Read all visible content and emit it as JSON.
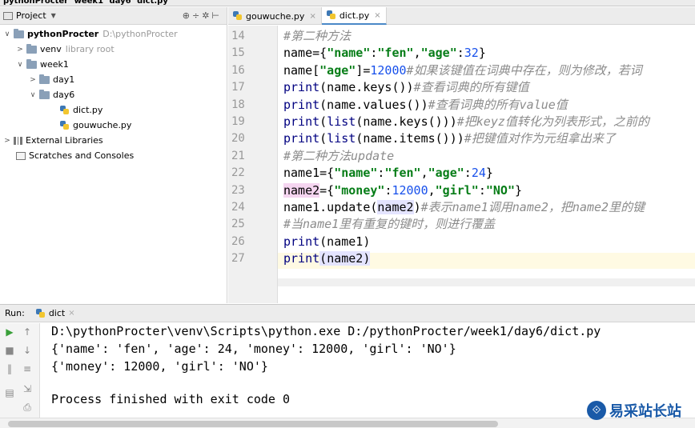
{
  "breadcrumb": [
    "pythonProcter",
    "week1",
    "day6",
    "dict.py"
  ],
  "project_panel": {
    "title": "Project",
    "tree": [
      {
        "label": "pythonProcter",
        "extra": "D:\\pythonProcter",
        "toggle": "∨"
      },
      {
        "label": "venv",
        "extra": "library root",
        "toggle": ">"
      },
      {
        "label": "week1",
        "extra": "",
        "toggle": "∨"
      },
      {
        "label": "day1",
        "extra": "",
        "toggle": ">"
      },
      {
        "label": "day6",
        "extra": "",
        "toggle": "∨"
      },
      {
        "label": "dict.py",
        "extra": "",
        "toggle": ""
      },
      {
        "label": "gouwuche.py",
        "extra": "",
        "toggle": ""
      },
      {
        "label": "External Libraries",
        "extra": "",
        "toggle": ">"
      },
      {
        "label": "Scratches and Consoles",
        "extra": "",
        "toggle": ""
      }
    ]
  },
  "editor": {
    "tabs": [
      {
        "label": "gouwuche.py",
        "active": false
      },
      {
        "label": "dict.py",
        "active": true
      }
    ],
    "line_numbers": [
      "14",
      "15",
      "16",
      "17",
      "18",
      "19",
      "20",
      "21",
      "22",
      "23",
      "24",
      "25",
      "26",
      "27"
    ],
    "lines": [
      [
        {
          "t": "#第二种方法",
          "k": "c"
        }
      ],
      [
        {
          "t": "name={",
          "k": ""
        },
        {
          "t": "\"name\"",
          "k": "s"
        },
        {
          "t": ":",
          "k": ""
        },
        {
          "t": "\"fen\"",
          "k": "s"
        },
        {
          "t": ",",
          "k": ""
        },
        {
          "t": "\"age\"",
          "k": "s"
        },
        {
          "t": ":",
          "k": ""
        },
        {
          "t": "32",
          "k": "n"
        },
        {
          "t": "}",
          "k": ""
        }
      ],
      [
        {
          "t": "name[",
          "k": ""
        },
        {
          "t": "\"age\"",
          "k": "s"
        },
        {
          "t": "]=",
          "k": ""
        },
        {
          "t": "12000",
          "k": "n"
        },
        {
          "t": "#如果该键值在词典中存在，则为修改，若词",
          "k": "c"
        }
      ],
      [
        {
          "t": "print",
          "k": "f"
        },
        {
          "t": "(name.keys())",
          "k": ""
        },
        {
          "t": "#查看词典的所有键值",
          "k": "c"
        }
      ],
      [
        {
          "t": "print",
          "k": "f"
        },
        {
          "t": "(name.values())",
          "k": ""
        },
        {
          "t": "#查看词典的所有value值",
          "k": "c"
        }
      ],
      [
        {
          "t": "print",
          "k": "f"
        },
        {
          "t": "(",
          "k": ""
        },
        {
          "t": "list",
          "k": "f"
        },
        {
          "t": "(name.keys()))",
          "k": ""
        },
        {
          "t": "#把keyz值转化为列表形式，之前的",
          "k": "c"
        }
      ],
      [
        {
          "t": "print",
          "k": "f"
        },
        {
          "t": "(",
          "k": ""
        },
        {
          "t": "list",
          "k": "f"
        },
        {
          "t": "(name.items()))",
          "k": ""
        },
        {
          "t": "#把键值对作为元组拿出来了",
          "k": "c"
        }
      ],
      [
        {
          "t": "#第二种方法update",
          "k": "c"
        }
      ],
      [
        {
          "t": "name1={",
          "k": ""
        },
        {
          "t": "\"name\"",
          "k": "s"
        },
        {
          "t": ":",
          "k": ""
        },
        {
          "t": "\"fen\"",
          "k": "s"
        },
        {
          "t": ",",
          "k": ""
        },
        {
          "t": "\"age\"",
          "k": "s"
        },
        {
          "t": ":",
          "k": ""
        },
        {
          "t": "24",
          "k": "n"
        },
        {
          "t": "}",
          "k": ""
        }
      ],
      [
        {
          "t": "name2",
          "k": "hl2"
        },
        {
          "t": "={",
          "k": ""
        },
        {
          "t": "\"money\"",
          "k": "s"
        },
        {
          "t": ":",
          "k": ""
        },
        {
          "t": "12000",
          "k": "n"
        },
        {
          "t": ",",
          "k": ""
        },
        {
          "t": "\"girl\"",
          "k": "s"
        },
        {
          "t": ":",
          "k": ""
        },
        {
          "t": "\"NO\"",
          "k": "s"
        },
        {
          "t": "}",
          "k": ""
        }
      ],
      [
        {
          "t": "name1.update(",
          "k": ""
        },
        {
          "t": "name2",
          "k": "hl"
        },
        {
          "t": ")",
          "k": ""
        },
        {
          "t": "#表示name1调用name2，把name2里的键",
          "k": "c"
        }
      ],
      [
        {
          "t": "#当name1里有重复的键时，则进行覆盖",
          "k": "c"
        }
      ],
      [
        {
          "t": "print",
          "k": "f"
        },
        {
          "t": "(name1)",
          "k": ""
        }
      ],
      [
        {
          "t": "print",
          "k": "f"
        },
        {
          "t": "(",
          "k": "hl"
        },
        {
          "t": "name2",
          "k": "hl"
        },
        {
          "t": ")",
          "k": "hl"
        }
      ]
    ]
  },
  "run_panel": {
    "label": "Run:",
    "tab": "dict",
    "output": [
      "D:\\pythonProcter\\venv\\Scripts\\python.exe D:/pythonProcter/week1/day6/dict.py",
      "{'name': 'fen', 'age': 24, 'money': 12000, 'girl': 'NO'}",
      "{'money': 12000, 'girl': 'NO'}",
      "",
      "Process finished with exit code 0"
    ]
  },
  "watermark": "易采站长站"
}
